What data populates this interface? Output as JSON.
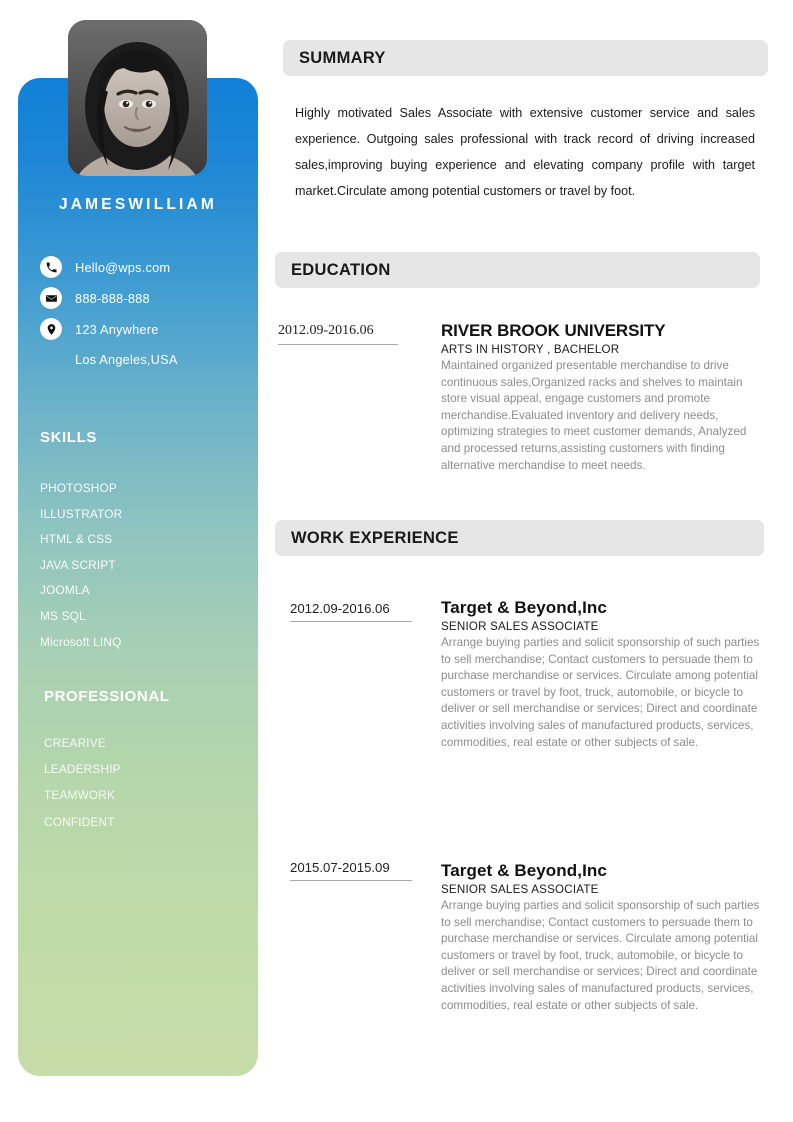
{
  "document": {
    "type": "resume",
    "page_background": "#ffffff"
  },
  "sidebar": {
    "accent_top_color": "#1180d8",
    "accent_bottom_color": "#c6dca9",
    "photo": {
      "icon": "profile-photo",
      "alt": "Black and white portrait photo of a smiling woman"
    },
    "name": "JAMESWILLIAM",
    "contacts": [
      {
        "icon": "phone-icon",
        "text": "Hello@wps.com"
      },
      {
        "icon": "envelope-icon",
        "text": "888-888-888"
      },
      {
        "icon": "location-pin-icon",
        "text": "123 Anywhere"
      }
    ],
    "contact_extra_line": "Los Angeles,USA",
    "skills": {
      "heading": "SKILLS",
      "items": [
        "PHOTOSHOP",
        "ILLUSTRATOR",
        "HTML & CSS",
        "JAVA SCRIPT",
        "JOOMLA",
        "MS SQL",
        "Microsoft LINQ"
      ]
    },
    "professional": {
      "heading": "PROFESSIONAL",
      "items": [
        "CREARIVE",
        "LEADERSHIP",
        "TEAMWORK",
        "CONFIDENT"
      ]
    }
  },
  "main": {
    "summary": {
      "heading": "SUMMARY",
      "text": "Highly motivated Sales Associate with extensive customer service and sales experience. Outgoing sales professional with track record of driving increased sales,improving buying experience and elevating company profile with target market.Circulate among potential customers or travel by foot."
    },
    "education": {
      "heading": "EDUCATION",
      "entries": [
        {
          "date": "2012.09-2016.06",
          "title": "RIVER BROOK UNIVERSITY",
          "subtitle": "ARTS IN HISTORY , BACHELOR",
          "description": "Maintained organized presentable merchandise to drive continuous sales,Organized racks and shelves to maintain store visual appeal, engage customers and promote merchandise.Evaluated inventory and delivery needs, optimizing strategies to meet customer demands, Analyzed and processed returns,assisting customers with finding alternative merchandise to meet needs."
        }
      ]
    },
    "work_experience": {
      "heading": "WORK EXPERIENCE",
      "entries": [
        {
          "date": "2012.09-2016.06",
          "title": "Target & Beyond,Inc",
          "subtitle": "SENIOR SALES ASSOCIATE",
          "description": "Arrange buying parties and solicit sponsorship of such parties to sell merchandise; Contact customers to persuade them to purchase merchandise or services. Circulate among potential customers or travel by foot, truck, automobile, or bicycle to deliver or sell merchandise or services; Direct and coordinate activities involving sales of manufactured products, services, commodities, real estate or other subjects of sale."
        },
        {
          "date": "2015.07-2015.09",
          "title": "Target & Beyond,Inc",
          "subtitle": "SENIOR SALES ASSOCIATE",
          "description": "Arrange buying parties and solicit sponsorship of such parties to sell merchandise; Contact customers to persuade them to purchase merchandise or services. Circulate among potential customers or travel by foot, truck, automobile, or bicycle to deliver or sell merchandise or services; Direct and coordinate activities involving sales of manufactured products, services, commodities, real estate or other subjects of sale."
        }
      ]
    }
  }
}
